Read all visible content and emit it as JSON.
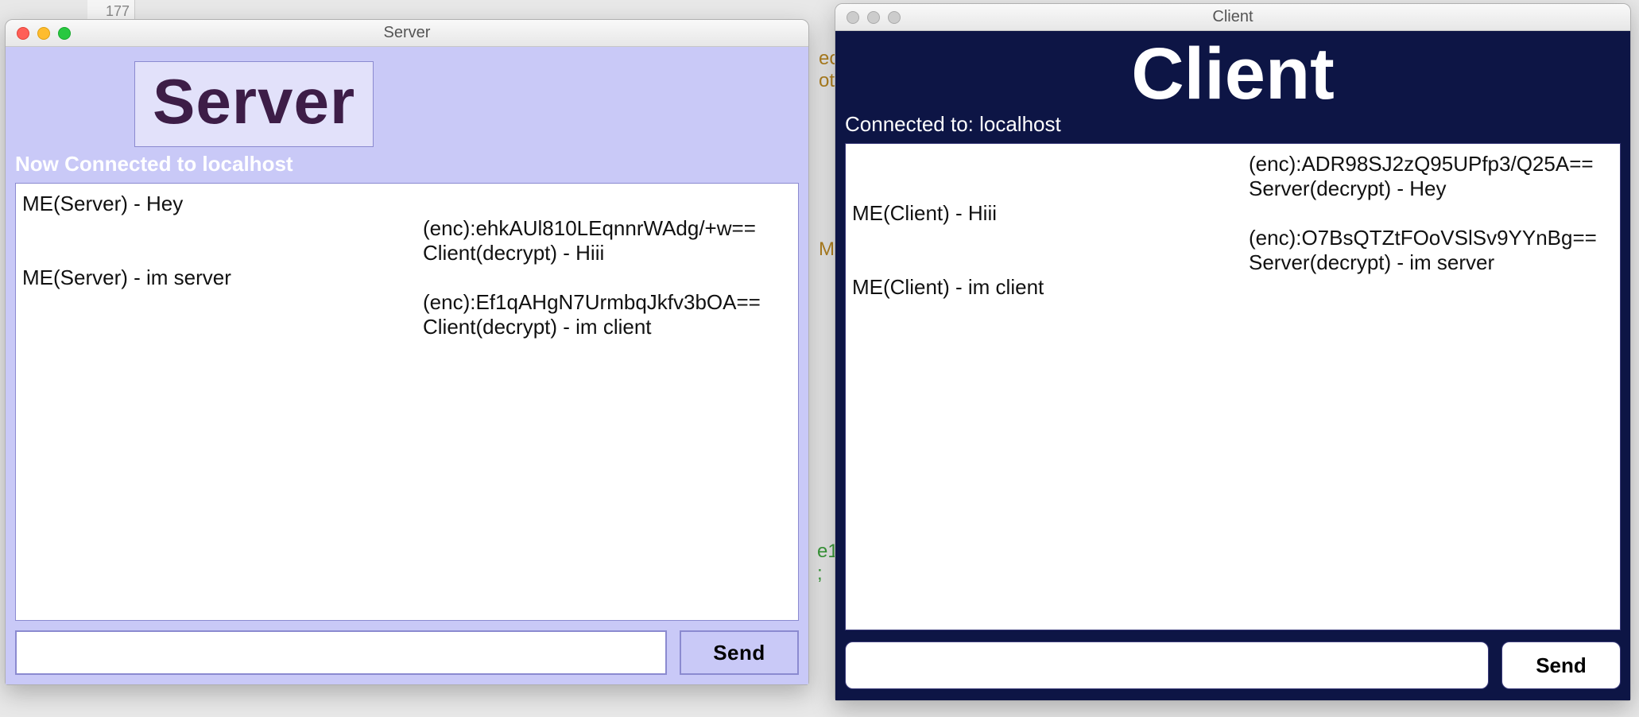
{
  "background": {
    "gutter_line": "177",
    "snippet1": "ec\not",
    "snippet2": "M",
    "snippet3": "e1\n;"
  },
  "server": {
    "window_title": "Server",
    "heading": "Server",
    "status": "Now Connected to localhost",
    "left_lines": "ME(Server) - Hey\n\n\nME(Server) - im server",
    "right_lines": "\n(enc):ehkAUl810LEqnnrWAdg/+w==\nClient(decrypt) - Hiii\n\n(enc):Ef1qAHgN7UrmbqJkfv3bOA==\nClient(decrypt) - im client",
    "input_value": "",
    "send_label": "Send"
  },
  "client": {
    "window_title": "Client",
    "heading": "Client",
    "status": "Connected to: localhost",
    "left_lines": "\n\nME(Client) - Hiii\n\n\nME(Client) - im client",
    "right_lines": "(enc):ADR98SJ2zQ95UPfp3/Q25A==\nServer(decrypt) - Hey\n\n(enc):O7BsQTZtFOoVSlSv9YYnBg==\nServer(decrypt) - im server",
    "input_value": "",
    "send_label": "Send"
  }
}
